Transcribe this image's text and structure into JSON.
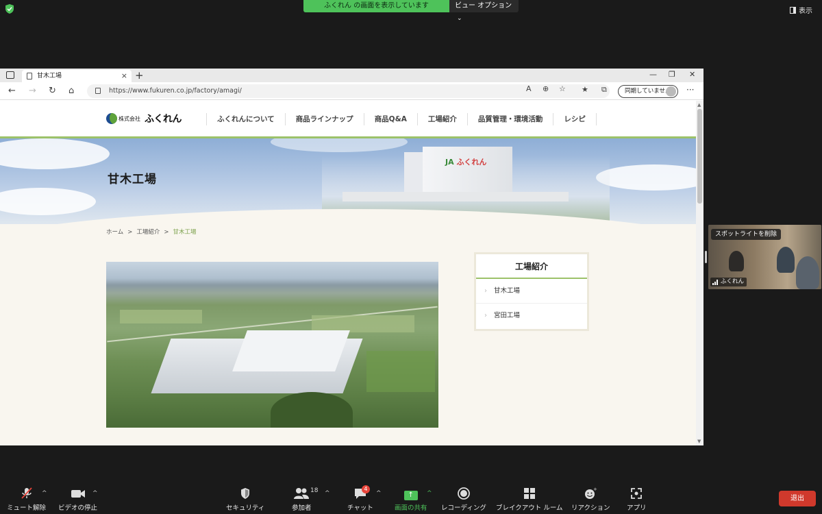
{
  "zoom": {
    "share_banner": "ふくれん の画面を表示しています",
    "view_options": "ビュー オプション",
    "show_label": "表示",
    "spotlight_remove": "スポットライトを削除",
    "participant_name": "ふくれん",
    "participants_count": "18",
    "chat_badge": "4",
    "leave": "退出",
    "toolbar": {
      "mute": "ミュート解除",
      "video": "ビデオの停止",
      "security": "セキュリティ",
      "participants": "参加者",
      "chat": "チャット",
      "share": "画面の共有",
      "record": "レコーディング",
      "breakout": "ブレイクアウト ルーム",
      "reactions": "リアクション",
      "apps": "アプリ"
    },
    "colors": {
      "share_green": "#4ec25a",
      "leave_red": "#d0392c"
    }
  },
  "browser": {
    "tab_title": "甘木工場",
    "url": "https://www.fukuren.co.jp/factory/amagi/",
    "sync_label": "同期していません"
  },
  "site": {
    "logo_company": "株式会社",
    "logo_name": "ふくれん",
    "nav": [
      "ふくれんについて",
      "商品ラインナップ",
      "商品Q&A",
      "工場紹介",
      "品質管理・環境活動",
      "レシピ"
    ],
    "hero_title": "甘木工場",
    "factory_sign": "ふくれん",
    "breadcrumb": [
      "ホーム",
      "工場紹介",
      "甘木工場"
    ],
    "breadcrumb_sep": ">",
    "side_title": "工場紹介",
    "side_items": [
      "甘木工場",
      "宮田工場"
    ],
    "colors": {
      "accent_green": "#9cc269"
    }
  }
}
